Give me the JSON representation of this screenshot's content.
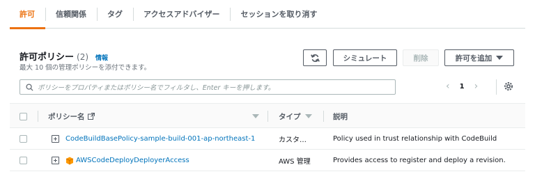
{
  "tabs": [
    {
      "label": "許可",
      "active": true
    },
    {
      "label": "信頼関係",
      "active": false
    },
    {
      "label": "タグ",
      "active": false
    },
    {
      "label": "アクセスアドバイザー",
      "active": false
    },
    {
      "label": "セッションを取り消す",
      "active": false
    }
  ],
  "panel": {
    "title": "許可ポリシー",
    "count": "(2)",
    "info": "情報",
    "description": "最大 10 個の管理ポリシーを添付できます。"
  },
  "actions": {
    "refresh_icon": "refresh-icon",
    "simulate": "シミュレート",
    "delete": "削除",
    "add_permissions": "許可を追加"
  },
  "search": {
    "placeholder": "ポリシーをプロパティまたはポリシー名でフィルタし、Enter キーを押します。"
  },
  "pagination": {
    "page": "1"
  },
  "table": {
    "headers": {
      "policy_name": "ポリシー名",
      "type": "タイプ",
      "description": "説明"
    },
    "rows": [
      {
        "name": "CodeBuildBasePolicy-sample-build-001-ap-northeast-1",
        "type": "カスタ…",
        "description": "Policy used in trust relationship with CodeBuild",
        "aws_icon": false
      },
      {
        "name": "AWSCodeDeployDeployerAccess",
        "type": "AWS 管理",
        "description": "Provides access to register and deploy a revision.",
        "aws_icon": true
      }
    ]
  },
  "colors": {
    "accent": "#ec7211",
    "link": "#0073bb",
    "text": "#16191f",
    "muted": "#687078"
  }
}
